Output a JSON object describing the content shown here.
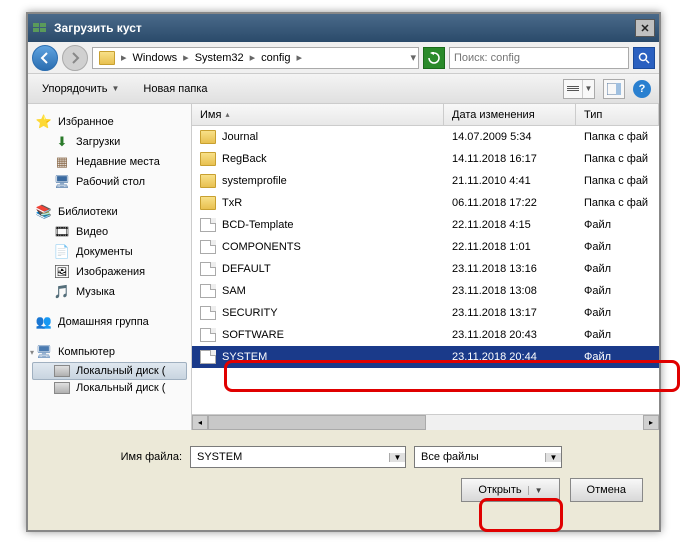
{
  "title": "Загрузить куст",
  "breadcrumb": [
    "Windows",
    "System32",
    "config"
  ],
  "search": {
    "placeholder": "Поиск: config"
  },
  "toolbar": {
    "organize": "Упорядочить",
    "newfolder": "Новая папка"
  },
  "sidebar": {
    "favorites": {
      "label": "Избранное",
      "items": [
        "Загрузки",
        "Недавние места",
        "Рабочий стол"
      ]
    },
    "libraries": {
      "label": "Библиотеки",
      "items": [
        "Видео",
        "Документы",
        "Изображения",
        "Музыка"
      ]
    },
    "homegroup": {
      "label": "Домашняя группа"
    },
    "computer": {
      "label": "Компьютер",
      "items": [
        "Локальный диск (",
        "Локальный диск ("
      ]
    }
  },
  "columns": {
    "name": "Имя",
    "date": "Дата изменения",
    "type": "Тип"
  },
  "files": [
    {
      "icon": "folder",
      "name": "Journal",
      "date": "14.07.2009 5:34",
      "type": "Папка с фай"
    },
    {
      "icon": "folder",
      "name": "RegBack",
      "date": "14.11.2018 16:17",
      "type": "Папка с фай"
    },
    {
      "icon": "folder",
      "name": "systemprofile",
      "date": "21.11.2010 4:41",
      "type": "Папка с фай"
    },
    {
      "icon": "folder",
      "name": "TxR",
      "date": "06.11.2018 17:22",
      "type": "Папка с фай"
    },
    {
      "icon": "file",
      "name": "BCD-Template",
      "date": "22.11.2018 4:15",
      "type": "Файл"
    },
    {
      "icon": "file",
      "name": "COMPONENTS",
      "date": "22.11.2018 1:01",
      "type": "Файл"
    },
    {
      "icon": "file",
      "name": "DEFAULT",
      "date": "23.11.2018 13:16",
      "type": "Файл"
    },
    {
      "icon": "file",
      "name": "SAM",
      "date": "23.11.2018 13:08",
      "type": "Файл"
    },
    {
      "icon": "file",
      "name": "SECURITY",
      "date": "23.11.2018 13:17",
      "type": "Файл"
    },
    {
      "icon": "file",
      "name": "SOFTWARE",
      "date": "23.11.2018 20:43",
      "type": "Файл"
    },
    {
      "icon": "file",
      "name": "SYSTEM",
      "date": "23.11.2018 20:44",
      "type": "Файл",
      "selected": true
    }
  ],
  "filename": {
    "label": "Имя файла:",
    "value": "SYSTEM"
  },
  "filter": {
    "value": "Все файлы"
  },
  "buttons": {
    "open": "Открыть",
    "cancel": "Отмена"
  }
}
